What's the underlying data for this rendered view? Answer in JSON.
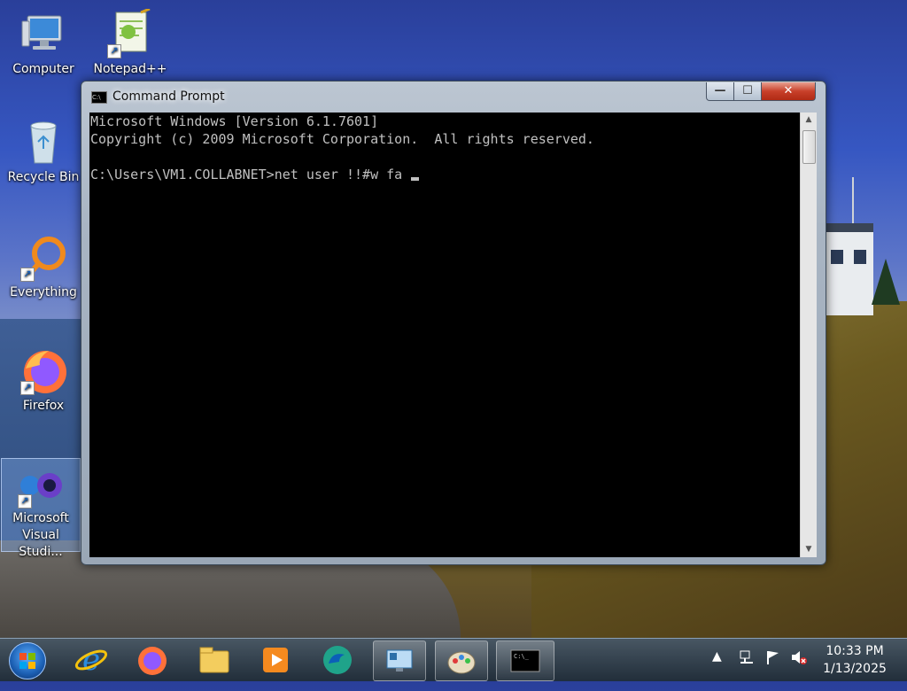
{
  "desktop": {
    "icons": [
      {
        "label": "Computer",
        "icon": "computer-icon"
      },
      {
        "label": "Notepad++",
        "icon": "notepadpp-icon"
      },
      {
        "label": "Recycle Bin",
        "icon": "recycle-bin-icon"
      },
      {
        "label": "Everything",
        "icon": "everything-icon"
      },
      {
        "label": "Firefox",
        "icon": "firefox-icon"
      },
      {
        "label": "Microsoft Visual Studi...",
        "icon": "visual-studio-icon"
      }
    ]
  },
  "window": {
    "title": "Command Prompt",
    "minimize": "—",
    "maximize": "☐",
    "close": "✕",
    "console_lines": [
      "Microsoft Windows [Version 6.1.7601]",
      "Copyright (c) 2009 Microsoft Corporation.  All rights reserved.",
      "",
      "C:\\Users\\VM1.COLLABNET>net user !!#w fa "
    ]
  },
  "taskbar": {
    "items": [
      "internet-explorer-icon",
      "firefox-icon",
      "file-explorer-icon",
      "media-player-icon",
      "edge-icon",
      "remote-desktop-icon",
      "paint-icon",
      "command-prompt-icon"
    ],
    "active_item": "command-prompt-icon",
    "tray_icons": [
      "show-hidden-icons-arrow",
      "network-icon",
      "action-center-flag-icon",
      "volume-muted-icon"
    ],
    "time": "10:33 PM",
    "date": "1/13/2025"
  },
  "colors": {
    "console_bg": "#000000",
    "console_fg": "#c0c0c0",
    "close_button": "#c8402a"
  }
}
